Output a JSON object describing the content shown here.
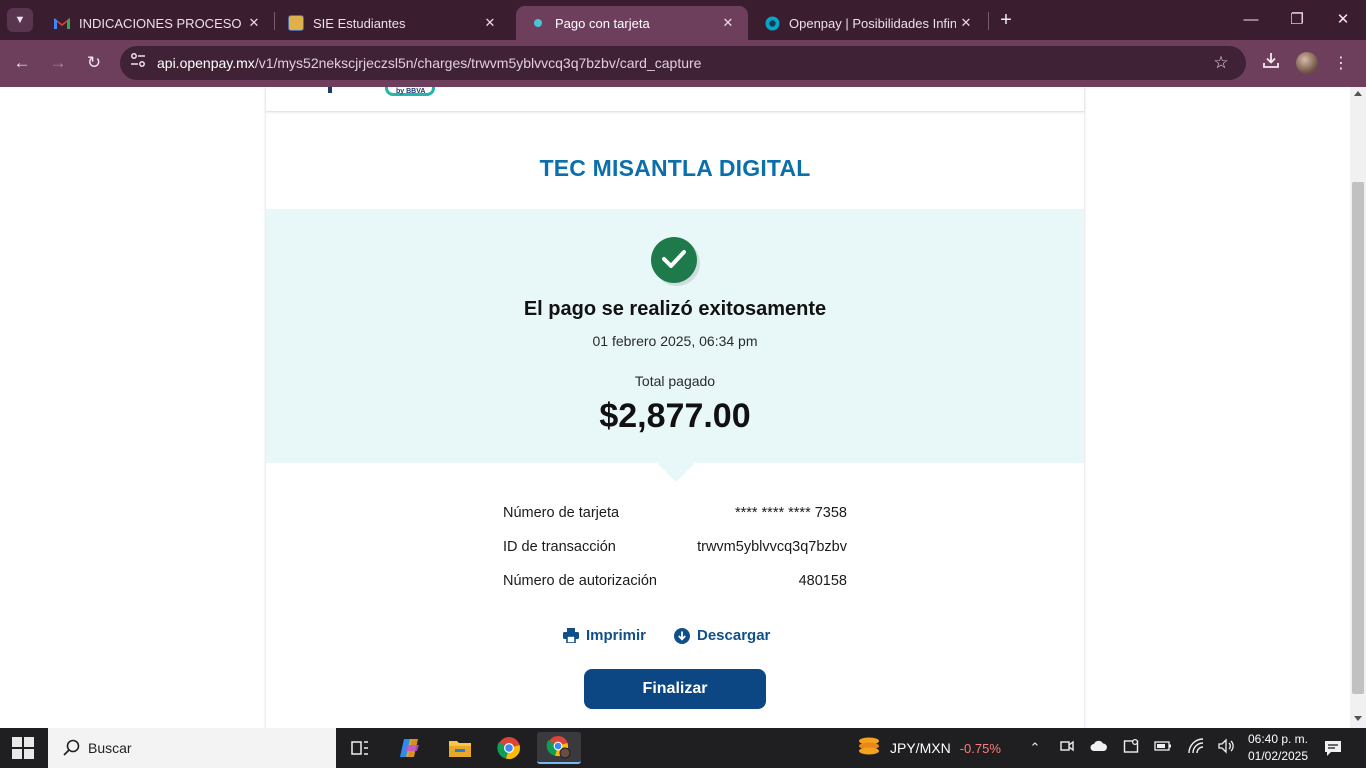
{
  "browser": {
    "tabs": [
      {
        "title": "INDICACIONES PROCESO DE RE",
        "favicon": "gmail-icon",
        "active": false
      },
      {
        "title": "SIE Estudiantes",
        "favicon": "sie-icon",
        "active": false
      },
      {
        "title": "Pago con tarjeta",
        "favicon": "openpay-dot-icon",
        "active": true
      },
      {
        "title": "Openpay | Posibilidades Infinitas",
        "favicon": "openpay-icon",
        "active": false
      }
    ],
    "url": {
      "host": "api.openpay.mx",
      "path": "/v1/mys52nekscjrjeczsl5n/charges/trwvm5yblvvcq3q7bzbv/card_capture"
    }
  },
  "page": {
    "logo_text": "by BBVA",
    "merchant_name": "TEC MISANTLA DIGITAL",
    "status_title": "El pago se realizó exitosamente",
    "date": "01 febrero 2025, 06:34 pm",
    "total_label": "Total pagado",
    "total_amount": "$2,877.00",
    "details": [
      {
        "label": "Número de tarjeta",
        "value": "**** **** **** 7358"
      },
      {
        "label": "ID de transacción",
        "value": "trwvm5yblvvcq3q7bzbv"
      },
      {
        "label": "Número de autorización",
        "value": "480158"
      }
    ],
    "actions": {
      "print_label": "Imprimir",
      "download_label": "Descargar"
    },
    "finish_label": "Finalizar"
  },
  "taskbar": {
    "search_placeholder": "Buscar",
    "ticker_name": "JPY/MXN",
    "ticker_change": "-0.75%",
    "clock_time": "06:40 p. m.",
    "clock_date": "01/02/2025"
  },
  "colors": {
    "brand_blue": "#0a6fab",
    "button_blue": "#0c4784",
    "success_green": "#1f7a4b",
    "success_band": "#e8f7f7",
    "browser_frame": "#6d3f5c"
  }
}
